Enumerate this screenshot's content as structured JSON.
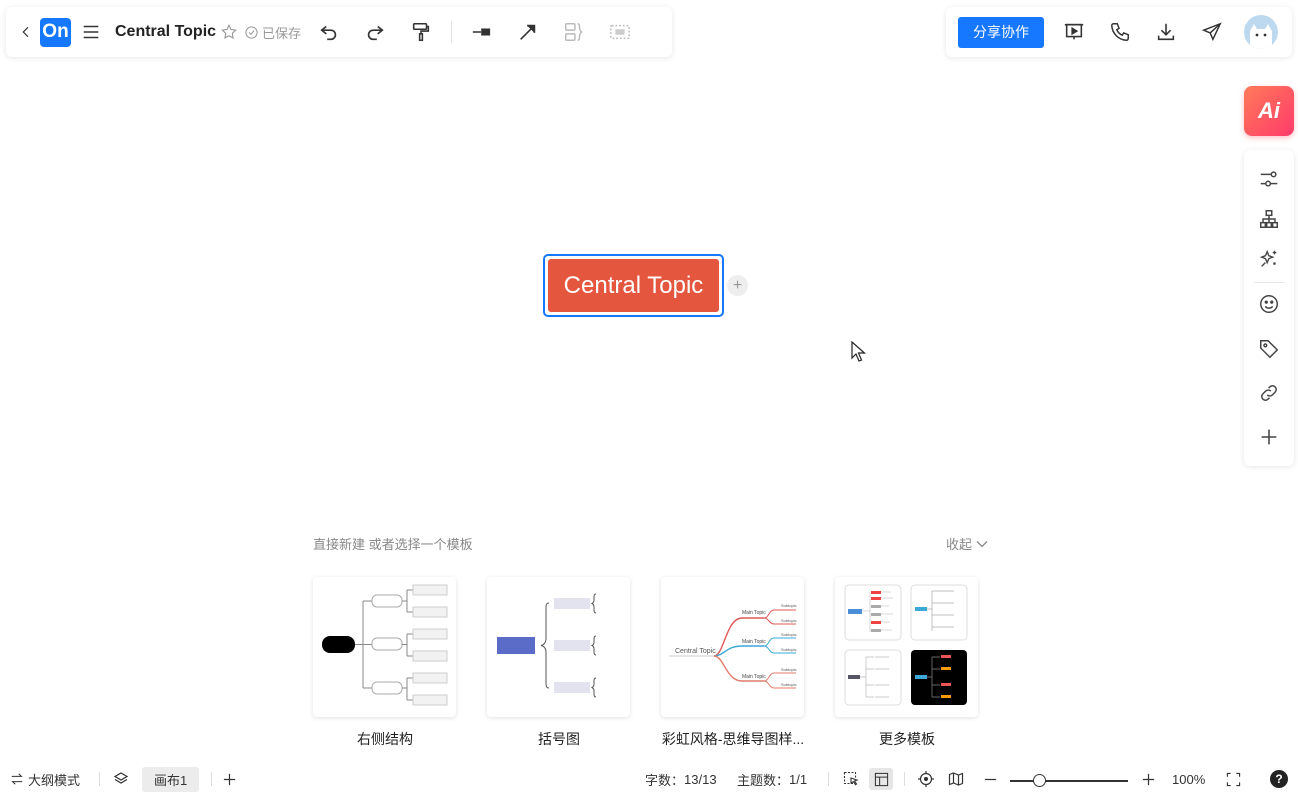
{
  "toolbar": {
    "logo_text": "On",
    "title": "Central Topic",
    "saved_label": "已保存",
    "share_label": "分享协作"
  },
  "ai": {
    "label": "Ai"
  },
  "canvas": {
    "central_topic": "Central Topic",
    "add_child": "+"
  },
  "templates": {
    "hint": "直接新建 或者选择一个模板",
    "collapse": "收起",
    "items": [
      {
        "label": "右侧结构"
      },
      {
        "label": "括号图"
      },
      {
        "label": "彩虹风格-思维导图样..."
      },
      {
        "label": "更多模板"
      }
    ],
    "rainbow_preview": {
      "central": "Central Topic",
      "main": "Main Topic",
      "sub": "Subtopic"
    }
  },
  "status_bar": {
    "outline_mode": "大纲模式",
    "canvas_tab": "画布1",
    "word_count_label": "字数：",
    "word_count_value": "13/13",
    "topic_count_label": "主题数：",
    "topic_count_value": "1/1",
    "zoom": "100%",
    "help": "?"
  },
  "colors": {
    "accent": "#1677ff",
    "topic": "#e5563f"
  }
}
